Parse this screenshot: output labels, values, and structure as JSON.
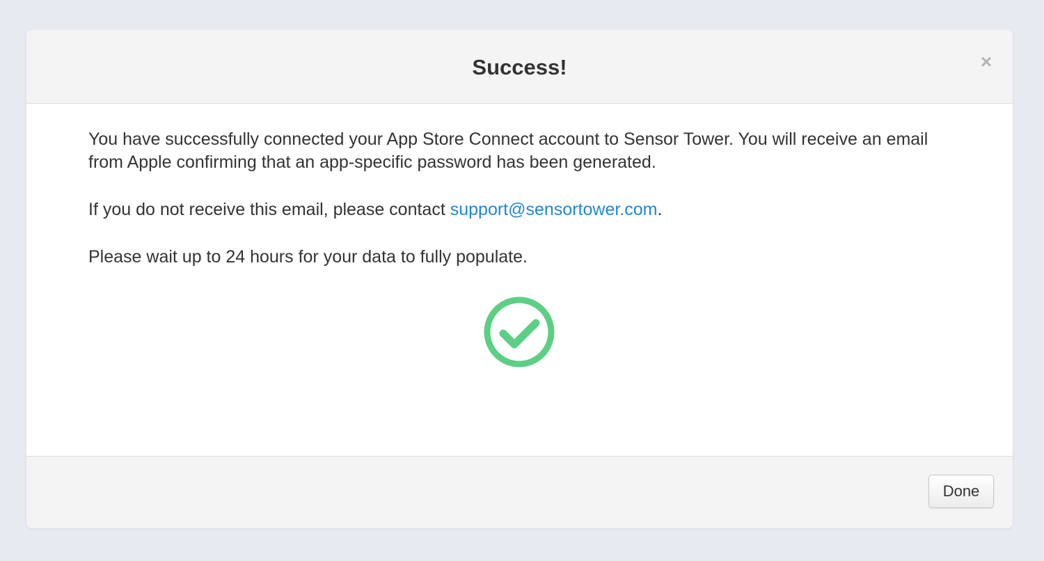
{
  "modal": {
    "title": "Success!",
    "close_glyph": "×",
    "paragraph_1": "You have successfully connected your App Store Connect account to Sensor Tower. You will receive an email from Apple confirming that an app-specific password has been generated.",
    "paragraph_2_prefix": "If you do not receive this email, please contact ",
    "support_email": "support@sensortower.com",
    "paragraph_2_suffix": ".",
    "paragraph_3": "Please wait up to 24 hours for your data to fully populate.",
    "status_icon": "check-circle-icon",
    "done_label": "Done"
  },
  "colors": {
    "page_background": "#e7eaf1",
    "header_background": "#f4f4f4",
    "success_green": "#5ccf84",
    "link_blue": "#1f88d4",
    "text": "#333333"
  }
}
